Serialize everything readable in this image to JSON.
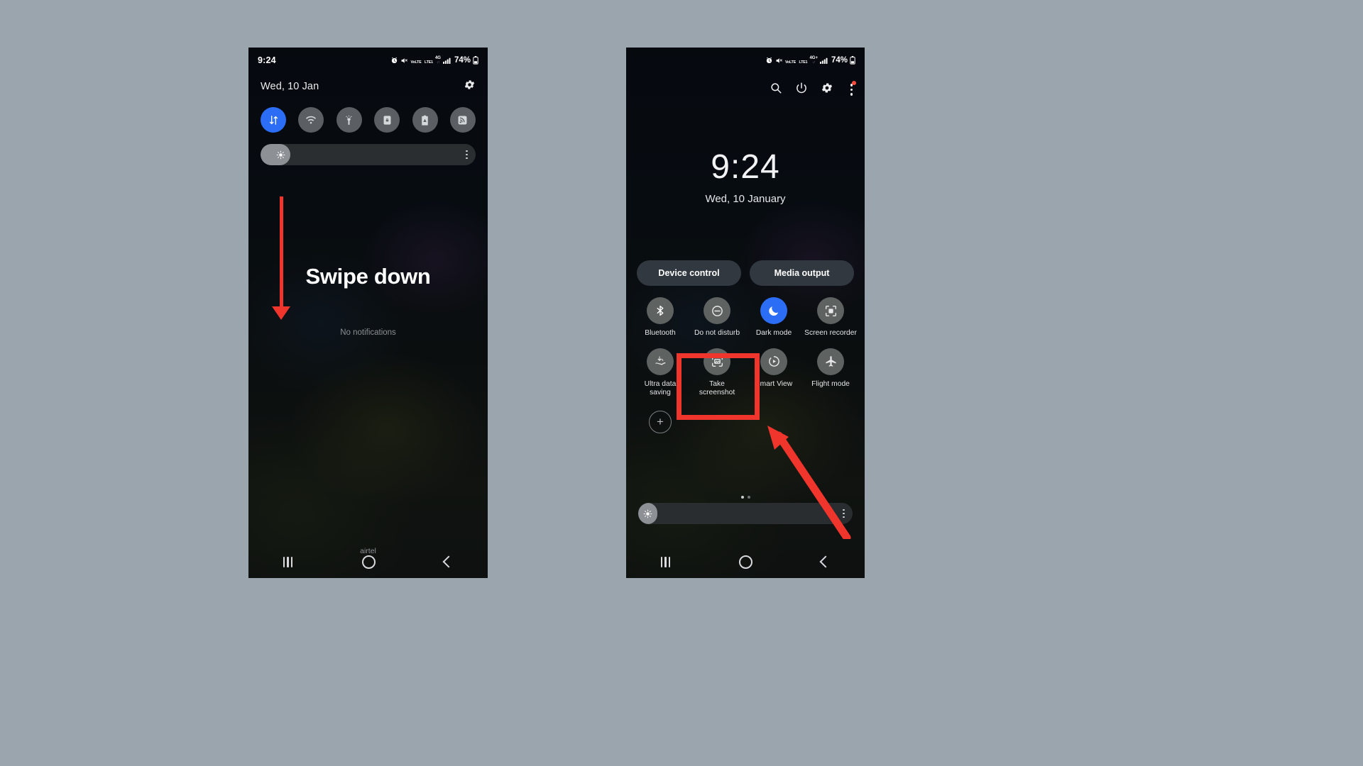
{
  "canvas": {
    "background": "#9aa5ae",
    "accent_red": "#f0352c",
    "accent_blue": "#2b6ef5"
  },
  "left_phone": {
    "name": "notification-shade-collapsed",
    "status_bar": {
      "time": "9:24",
      "battery_percent": "74%",
      "volte_top": "VoLTE",
      "volte_bottom": "LTE1",
      "network": "4G",
      "icons": [
        "alarm-icon",
        "mute-icon",
        "volte-icon",
        "network-4g-icon",
        "signal-bars-icon",
        "battery-icon"
      ]
    },
    "header": {
      "date": "Wed, 10 Jan",
      "settings_icon": "gear-icon"
    },
    "toggles": [
      {
        "name": "mobile-data",
        "icon": "data-arrows-icon",
        "active": true
      },
      {
        "name": "wifi",
        "icon": "wifi-icon",
        "active": false
      },
      {
        "name": "flashlight",
        "icon": "flashlight-icon",
        "active": false
      },
      {
        "name": "auto-rotate-lock",
        "icon": "rotation-lock-icon",
        "active": false
      },
      {
        "name": "power-saving",
        "icon": "battery-saver-icon",
        "active": false
      },
      {
        "name": "mobile-hotspot",
        "icon": "hotspot-icon",
        "active": false
      }
    ],
    "brightness": {
      "name": "brightness-slider",
      "fill_percent": 14,
      "icon": "sun-icon",
      "menu_icon": "kebab-icon"
    },
    "annotation_text": "Swipe down",
    "no_notifications": "No notifications",
    "carrier": "airtel",
    "nav": {
      "recents": "recents-button",
      "home": "home-button",
      "back": "back-button"
    }
  },
  "right_phone": {
    "name": "quick-panel-expanded",
    "status_bar": {
      "battery_percent": "74%",
      "volte_top": "VoLTE",
      "volte_bottom": "LTE1",
      "network": "4G+",
      "icons": [
        "alarm-icon",
        "mute-icon",
        "volte-icon",
        "network-4g-plus-icon",
        "signal-bars-icon",
        "battery-icon"
      ]
    },
    "header_icons": [
      {
        "name": "search-icon"
      },
      {
        "name": "power-icon"
      },
      {
        "name": "gear-icon"
      },
      {
        "name": "kebab-menu-icon",
        "badge": true
      }
    ],
    "clock": "9:24",
    "date": "Wed, 10 January",
    "pills": [
      {
        "label": "Device control"
      },
      {
        "label": "Media output"
      }
    ],
    "tiles": [
      {
        "label": "Bluetooth",
        "icon": "bluetooth-icon",
        "active": false
      },
      {
        "label": "Do not disturb",
        "icon": "do-not-disturb-icon",
        "active": false
      },
      {
        "label": "Dark mode",
        "icon": "moon-icon",
        "active": true
      },
      {
        "label": "Screen recorder",
        "icon": "screen-recorder-icon",
        "active": false
      },
      {
        "label": "Ultra data saving",
        "icon": "ultra-data-saving-icon",
        "active": false
      },
      {
        "label": "Take screenshot",
        "icon": "screenshot-icon",
        "active": false,
        "highlighted": true
      },
      {
        "label": "Smart View",
        "icon": "smart-view-icon",
        "active": false
      },
      {
        "label": "Flight mode",
        "icon": "airplane-icon",
        "active": false
      }
    ],
    "add_button": {
      "name": "add-tile-button",
      "label": "+"
    },
    "page_dots": {
      "total": 2,
      "current": 1
    },
    "brightness": {
      "name": "brightness-slider",
      "fill_percent": 8,
      "icon": "sun-icon",
      "menu_icon": "kebab-icon"
    },
    "nav": {
      "recents": "recents-button",
      "home": "home-button",
      "back": "back-button"
    }
  },
  "annotations": [
    {
      "name": "swipe-down-arrow",
      "shape": "arrow-down",
      "color": "#f0352c"
    },
    {
      "name": "take-screenshot-highlight-box",
      "shape": "rectangle",
      "color": "#f0352c"
    },
    {
      "name": "take-screenshot-pointer-arrow",
      "shape": "arrow-diagonal",
      "color": "#f0352c"
    }
  ]
}
